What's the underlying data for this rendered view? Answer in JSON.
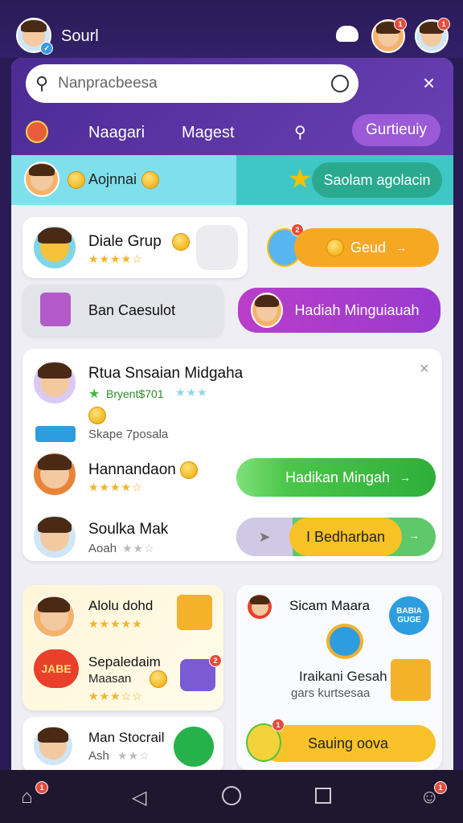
{
  "status_bar": {
    "user_name": "Sourl"
  },
  "search": {
    "placeholder": "Nanpracbeesa"
  },
  "nav": {
    "item1": "Naagari",
    "item2": "Magest",
    "cta": "Gurtieuiy"
  },
  "banner": {
    "user_text": "Aojnnai",
    "button": "Saolam agolacin"
  },
  "cards": {
    "group_title": "Diale Grup",
    "group_rating": "★★★★☆",
    "group_button": "Geud",
    "box_title": "Ban Caesulot",
    "gift_button": "Hadiah Minguiauah"
  },
  "list_card": {
    "title": "Rtua Snsaian Midgaha",
    "meta": "Bryent$701",
    "meta_stars": "★★★",
    "label": "Skape 7posala",
    "row1": {
      "name": "Hannandaon",
      "stars": "★★★★☆",
      "button": "Hadikan Mingah"
    },
    "row2": {
      "name": "Soulka Mak",
      "sub": "Aoah",
      "stars": "★★☆",
      "button": "I Bedharban"
    }
  },
  "bottom_left": {
    "item1_name": "Alolu dohd",
    "item1_stars": "★★★★★",
    "item2_name": "Sepaledaim",
    "item2_sub": "Maasan",
    "item2_stars": "★★★☆☆",
    "badge_text": "JABE"
  },
  "bottom_right": {
    "title": "Sicam Maara",
    "badge_text": "BABIA GUGE",
    "line1": "Iraikani Gesah",
    "line2": "gars kurtsesaa",
    "button": "Sauing oova"
  },
  "bottom_card3": {
    "name": "Man Stocrail",
    "sub": "Ash",
    "stars": "★★☆"
  },
  "colors": {
    "purple": "#5b34a5",
    "orange": "#f7a823",
    "green": "#4cc64a",
    "magenta": "#b03fc6",
    "cyan": "#7fe0ec"
  }
}
